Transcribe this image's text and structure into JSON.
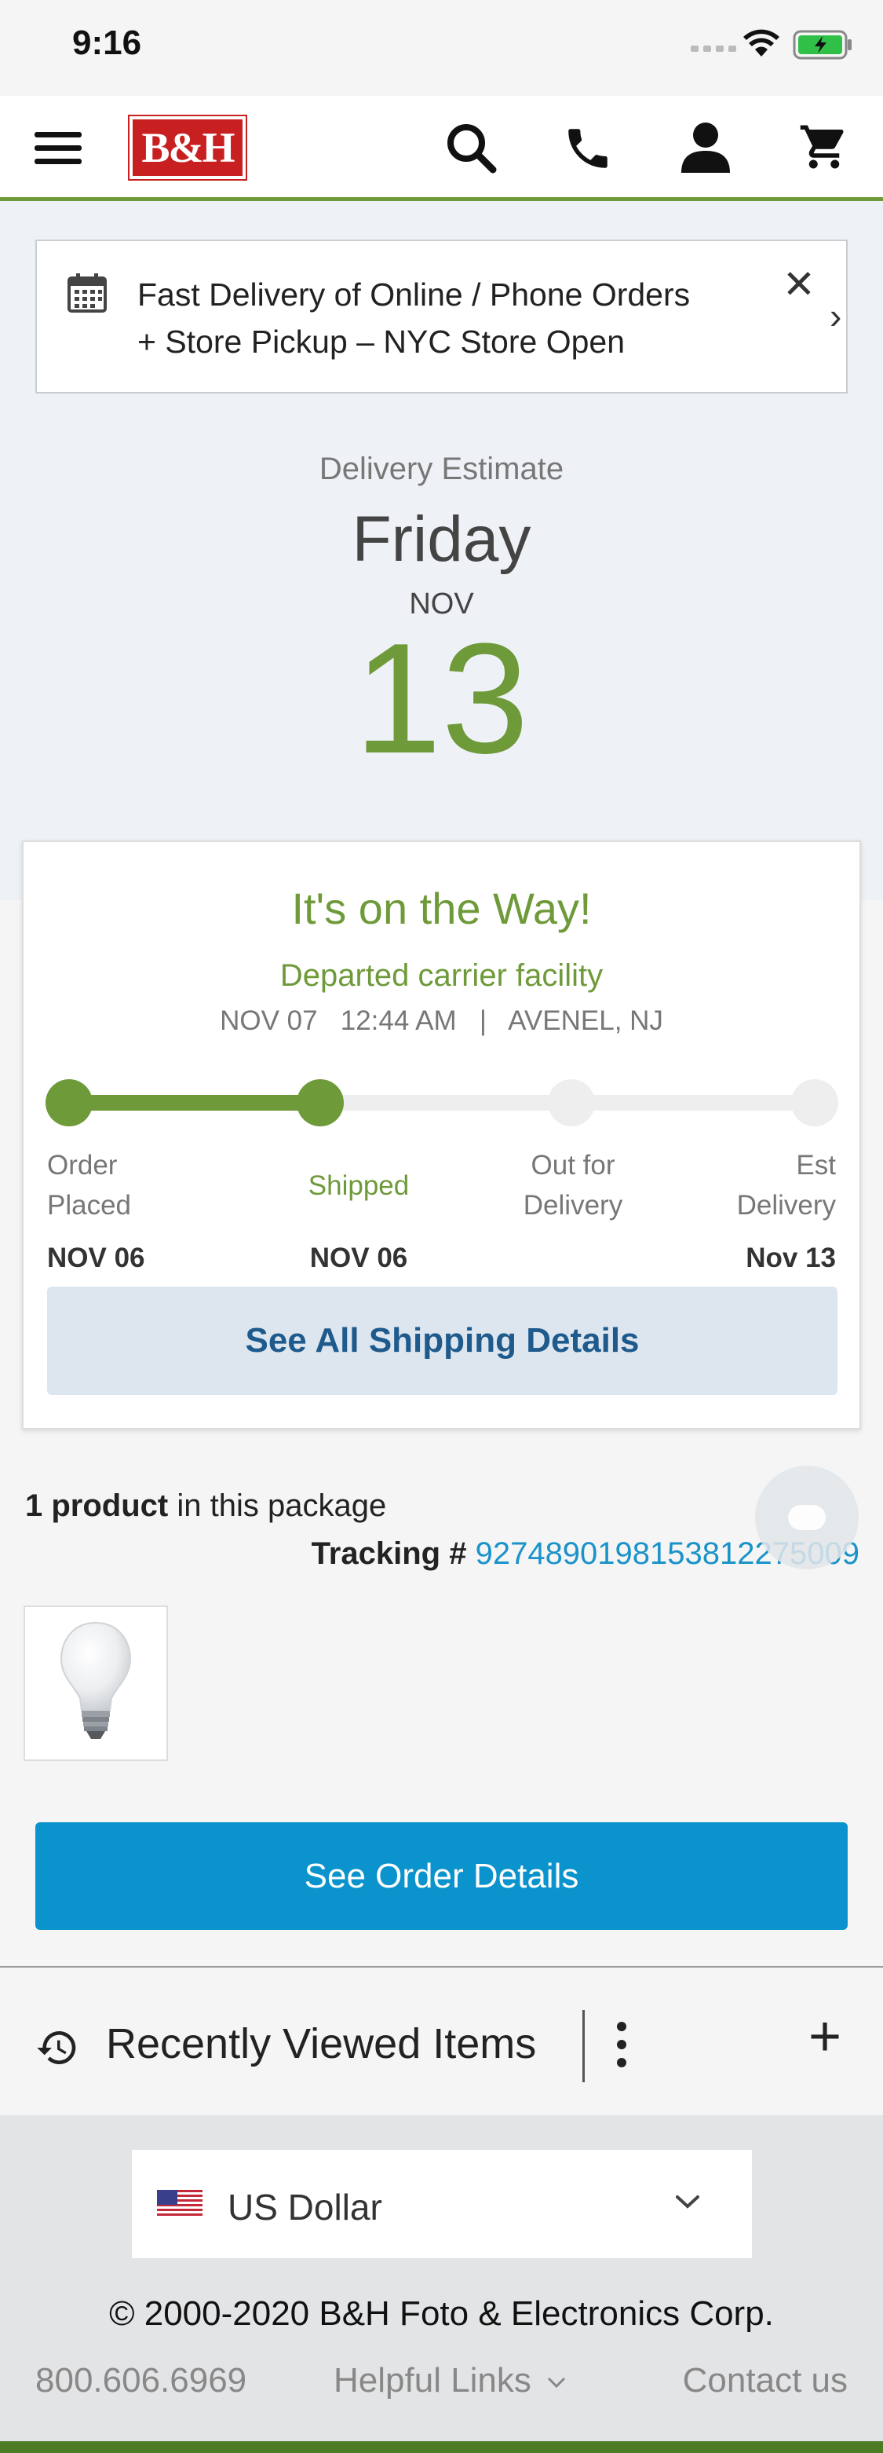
{
  "status_bar": {
    "time": "9:16"
  },
  "header": {
    "logo_text": "B&H"
  },
  "banner": {
    "line1": "Fast Delivery of Online / Phone Orders",
    "line2": "+ Store Pickup – NYC Store Open"
  },
  "estimate": {
    "label": "Delivery Estimate",
    "day": "Friday",
    "month": "NOV",
    "date": "13"
  },
  "tracking_card": {
    "headline": "It's on the Way!",
    "status": "Departed carrier facility",
    "event_date": "NOV 07",
    "event_time": "12:44 AM",
    "separator": "|",
    "event_location": "AVENEL, NJ",
    "progress_completed_steps": 2,
    "steps": [
      {
        "line1": "Order",
        "line2": "Placed",
        "date": "NOV 06"
      },
      {
        "line1": "Shipped",
        "line2": "",
        "date": "NOV 06"
      },
      {
        "line1": "Out for",
        "line2": "Delivery",
        "date": ""
      },
      {
        "line1": "Est",
        "line2": "Delivery",
        "date": "Nov 13"
      }
    ],
    "details_button": "See All Shipping Details"
  },
  "package": {
    "count": "1 product",
    "suffix": "in this package",
    "tracking_label": "Tracking #",
    "tracking_number": "9274890198153812275009"
  },
  "order_button": "See Order Details",
  "recent": {
    "title": "Recently Viewed Items"
  },
  "footer": {
    "currency": "US Dollar",
    "copyright": "© 2000-2020 B&H Foto & Electronics Corp.",
    "phone": "800.606.6969",
    "helpful": "Helpful Links",
    "contact": "Contact us"
  },
  "colors": {
    "brand_green": "#6e9a3a",
    "link_blue": "#1a93c9",
    "button_blue": "#0a93cc",
    "logo_red": "#c82020"
  }
}
